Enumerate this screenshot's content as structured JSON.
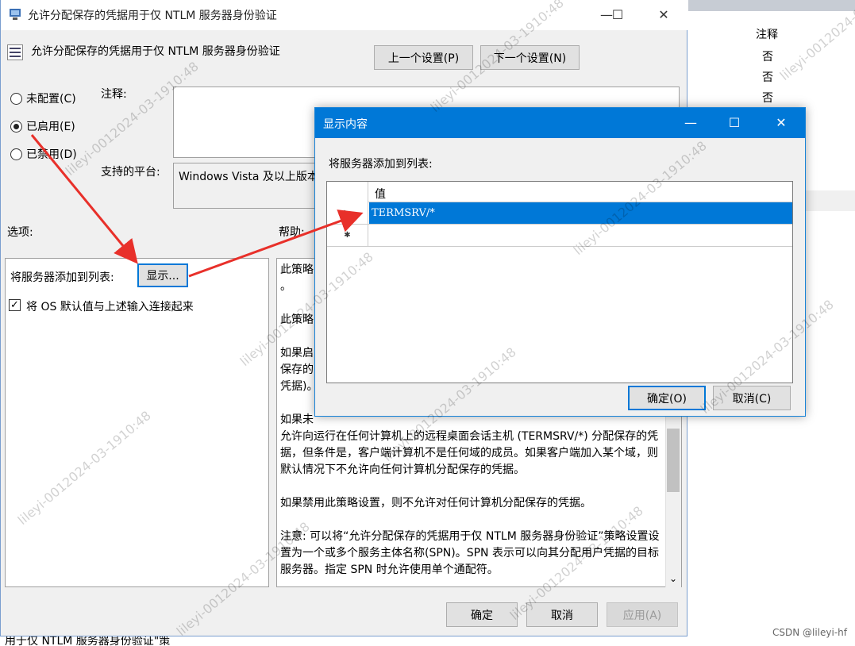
{
  "main_window": {
    "title": "允许分配保存的凭据用于仅 NTLM 服务器身份验证",
    "header_title": "允许分配保存的凭据用于仅 NTLM 服务器身份验证",
    "prev_button": "上一个设置(P)",
    "next_button": "下一个设置(N)",
    "radio_not_configured": "未配置(C)",
    "radio_enabled": "已启用(E)",
    "radio_disabled": "已禁用(D)",
    "selected_radio": "已启用(E)",
    "comment_label": "注释:",
    "platform_label": "支持的平台:",
    "platform_value": "Windows Vista 及以上版本",
    "options_label": "选项:",
    "help_label": "帮助:",
    "add_servers_label": "将服务器添加到列表:",
    "show_button": "显示...",
    "concat_checkbox_label": "将 OS 默认值与上述输入连接起来",
    "concat_checked": true,
    "help_text": "此策略\n。\n\n此策略\n\n如果启\n保存的\n凭据)。\n\n如果未\n允许向运行在任何计算机上的远程桌面会话主机 (TERMSRV/*) 分配保存的凭据，但条件是，客户端计算机不是任何域的成员。如果客户端加入某个域，则默认情况下不允许向任何计算机分配保存的凭据。\n\n如果禁用此策略设置，则不允许对任何计算机分配保存的凭据。\n\n注意: 可以将“允许分配保存的凭据用于仅 NTLM 服务器身份验证”策略设置设置为一个或多个服务主体名称(SPN)。SPN 表示可以向其分配用户凭据的目标服务器。指定 SPN 时允许使用单个通配符。\n\n例如:",
    "ok_button": "确定",
    "cancel_button": "取消",
    "apply_button": "应用(A)"
  },
  "dialog": {
    "title": "显示内容",
    "prompt": "将服务器添加到列表:",
    "column_header": "值",
    "rows": [
      "TERMSRV/*",
      ""
    ],
    "ok_button": "确定(O)",
    "cancel_button": "取消(C)"
  },
  "background": {
    "column_header": "注释",
    "cells": [
      "否",
      "否",
      "否"
    ],
    "bottom_text": "用于仅 NTLM 服务器身份验证\"策"
  },
  "watermark": "lileyi-0012024-03-1910:48",
  "csdn_label": "CSDN @lileyi-hf",
  "colors": {
    "dialog_title_bg": "#0078d7",
    "selection": "#0078d7",
    "arrow": "#e8302a",
    "window_bg": "#f0f0f0"
  }
}
